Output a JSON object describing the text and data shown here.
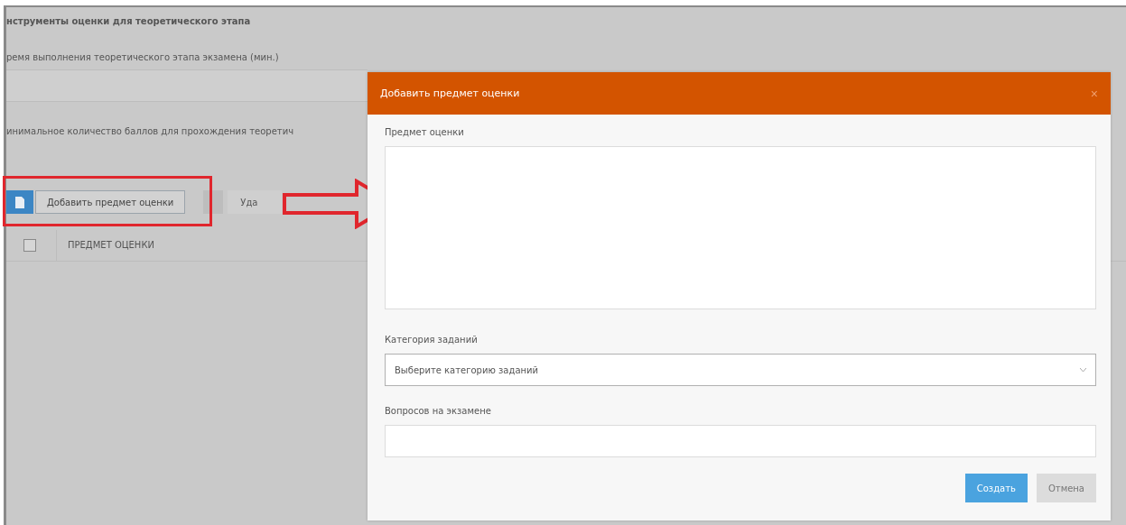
{
  "page": {
    "title": "нструменты оценки для теоретического этапа",
    "time_label": "ремя выполнения теоретического этапа экзамена (мин.)",
    "min_score_label": "инимальное количество баллов для прохождения теоретич"
  },
  "toolbar": {
    "add_button": "Добавить предмет оценки",
    "delete_button": "Уда"
  },
  "table": {
    "columns": [
      {
        "label": "ПРЕДМЕТ ОЦЕНКИ"
      }
    ],
    "select_all": {
      "checked": false
    }
  },
  "dialog": {
    "title": "Добавить предмет оценки",
    "close": "×",
    "fields": [
      {
        "kind": "textarea",
        "label": "Предмет оценки"
      },
      {
        "kind": "select",
        "label": "Категория заданий",
        "placeholder": "Выберите категорию заданий"
      },
      {
        "kind": "input",
        "label": "Вопросов на экзамене"
      }
    ],
    "buttons": [
      {
        "label": "Создать",
        "kind": "primary"
      },
      {
        "label": "Отмена",
        "kind": "secondary"
      }
    ]
  }
}
